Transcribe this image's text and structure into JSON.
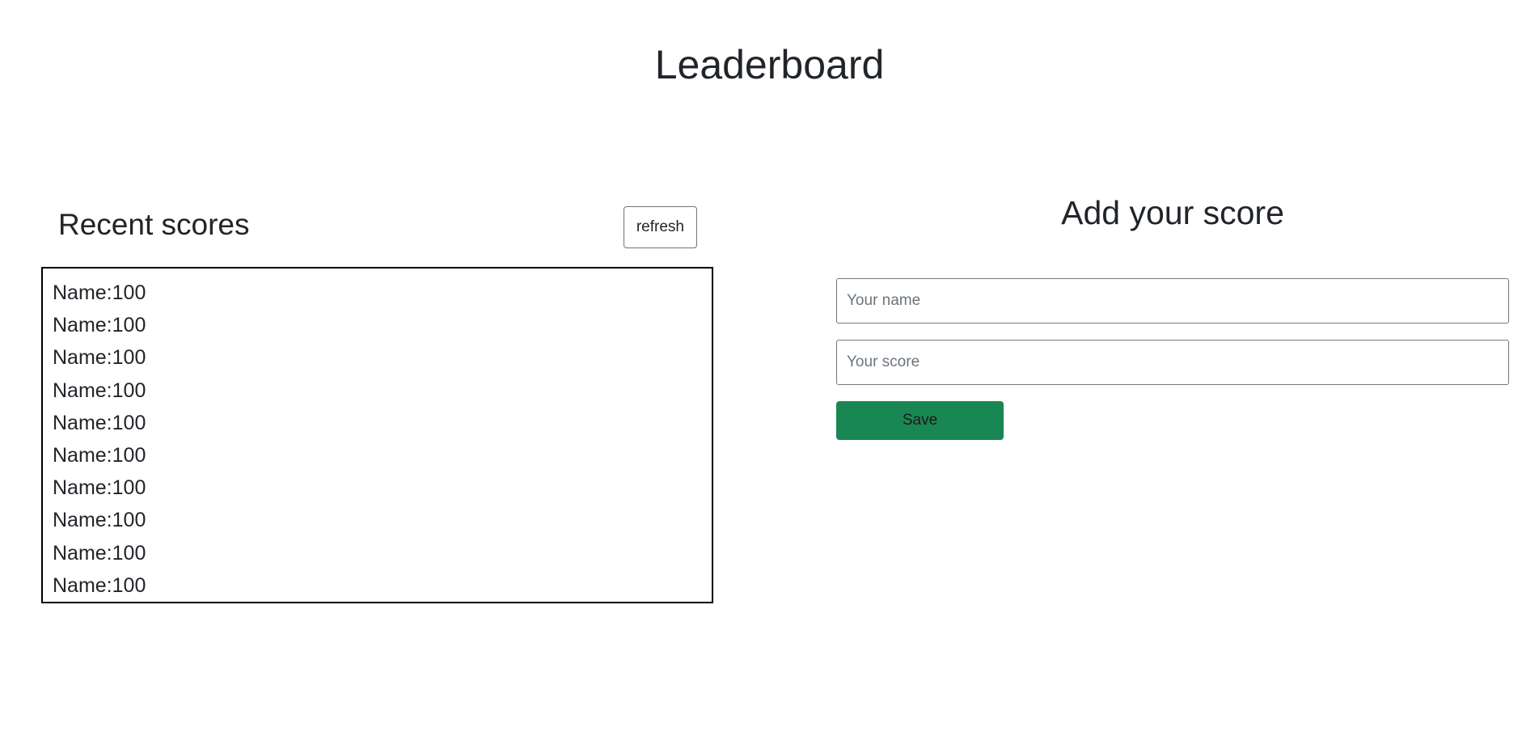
{
  "page": {
    "title": "Leaderboard"
  },
  "recent_scores": {
    "title": "Recent scores",
    "refresh_label": "refresh",
    "items": [
      "Name:100",
      "Name:100",
      "Name:100",
      "Name:100",
      "Name:100",
      "Name:100",
      "Name:100",
      "Name:100",
      "Name:100",
      "Name:100"
    ]
  },
  "add_score": {
    "title": "Add your score",
    "name_placeholder": "Your name",
    "name_value": "",
    "score_placeholder": "Your score",
    "score_value": "",
    "save_label": "Save"
  },
  "colors": {
    "save_button": "#198754",
    "list_border": "#000000",
    "text": "#212529"
  }
}
